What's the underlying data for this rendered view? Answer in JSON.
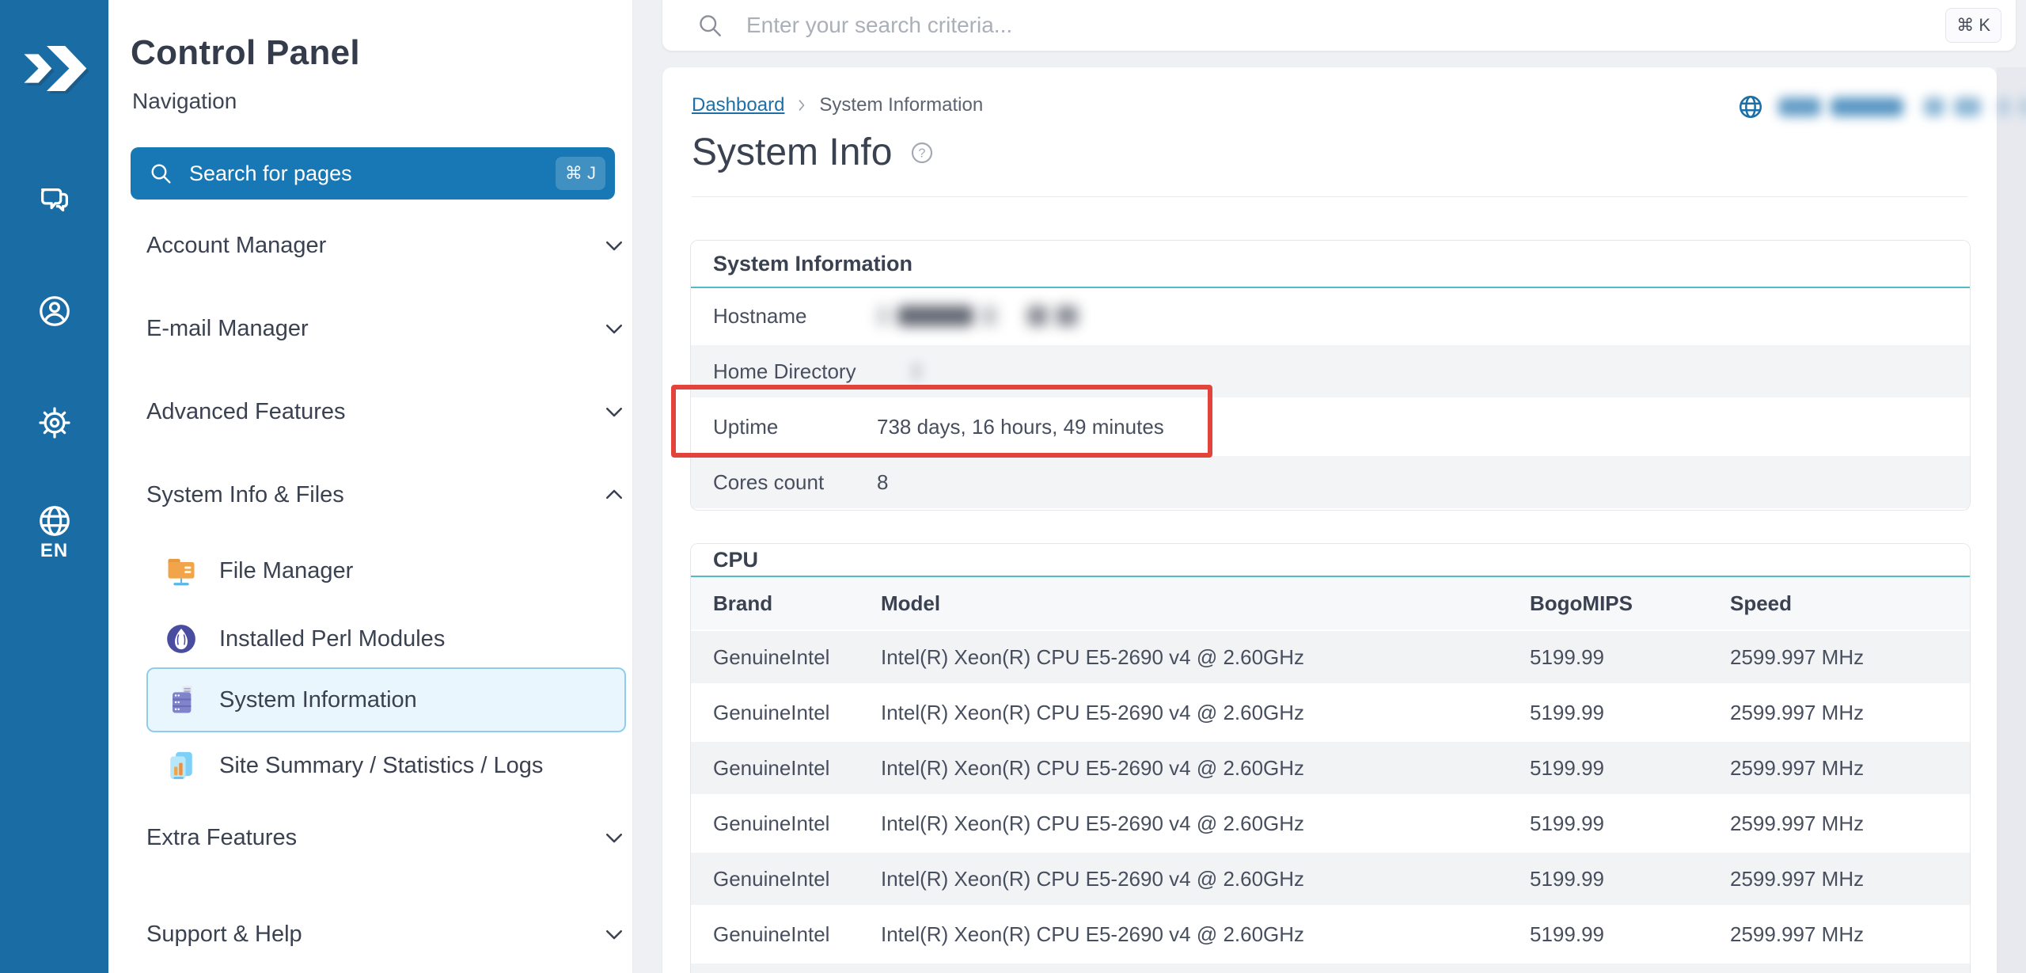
{
  "colors": {
    "rail_blue": "#1a6ca4",
    "accent_blue": "#1778b5",
    "link_blue": "#1e6fa5",
    "teal_underline": "#54bbc2",
    "annotation_red": "#e2443c",
    "selected_item_bg": "#eaf6fd",
    "selected_item_border": "#90cdec"
  },
  "rail": {
    "language_label": "EN",
    "icons": [
      "chat-icon",
      "user-circle-icon",
      "gear-icon",
      "globe-icon"
    ]
  },
  "sidebar": {
    "title": "Control Panel",
    "subtitle": "Navigation",
    "search": {
      "label": "Search for pages",
      "shortcut": "⌘ J"
    },
    "sections": [
      {
        "label": "Account Manager",
        "state": "collapsed"
      },
      {
        "label": "E-mail Manager",
        "state": "collapsed"
      },
      {
        "label": "Advanced Features",
        "state": "collapsed"
      },
      {
        "label": "System Info & Files",
        "state": "expanded"
      }
    ],
    "system_items": [
      {
        "label": "File Manager",
        "icon": "folder-icon",
        "selected": false
      },
      {
        "label": "Installed Perl Modules",
        "icon": "perl-icon",
        "selected": false
      },
      {
        "label": "System Information",
        "icon": "server-icon",
        "selected": true
      },
      {
        "label": "Site Summary / Statistics / Logs",
        "icon": "stats-icon",
        "selected": false
      }
    ],
    "more_sections": [
      {
        "label": "Extra Features",
        "state": "collapsed"
      },
      {
        "label": "Support & Help",
        "state": "collapsed"
      }
    ]
  },
  "topbar": {
    "search_placeholder": "Enter your search criteria...",
    "shortcut": "⌘ K"
  },
  "breadcrumb": {
    "home": "Dashboard",
    "current": "System Information"
  },
  "page": {
    "title": "System Info"
  },
  "system_info": {
    "title": "System Information",
    "rows": [
      {
        "label": "Hostname",
        "value": "",
        "redacted": true
      },
      {
        "label": "Home Directory",
        "value": "",
        "redacted": true
      },
      {
        "label": "Uptime",
        "value": "738 days, 16 hours, 49 minutes",
        "highlighted": true
      },
      {
        "label": "Cores count",
        "value": "8"
      }
    ]
  },
  "cpu": {
    "title": "CPU",
    "columns": [
      "Brand",
      "Model",
      "BogoMIPS",
      "Speed"
    ],
    "rows": [
      [
        "GenuineIntel",
        "Intel(R) Xeon(R) CPU E5-2690 v4 @ 2.60GHz",
        "5199.99",
        "2599.997 MHz"
      ],
      [
        "GenuineIntel",
        "Intel(R) Xeon(R) CPU E5-2690 v4 @ 2.60GHz",
        "5199.99",
        "2599.997 MHz"
      ],
      [
        "GenuineIntel",
        "Intel(R) Xeon(R) CPU E5-2690 v4 @ 2.60GHz",
        "5199.99",
        "2599.997 MHz"
      ],
      [
        "GenuineIntel",
        "Intel(R) Xeon(R) CPU E5-2690 v4 @ 2.60GHz",
        "5199.99",
        "2599.997 MHz"
      ],
      [
        "GenuineIntel",
        "Intel(R) Xeon(R) CPU E5-2690 v4 @ 2.60GHz",
        "5199.99",
        "2599.997 MHz"
      ],
      [
        "GenuineIntel",
        "Intel(R) Xeon(R) CPU E5-2690 v4 @ 2.60GHz",
        "5199.99",
        "2599.997 MHz"
      ]
    ]
  }
}
